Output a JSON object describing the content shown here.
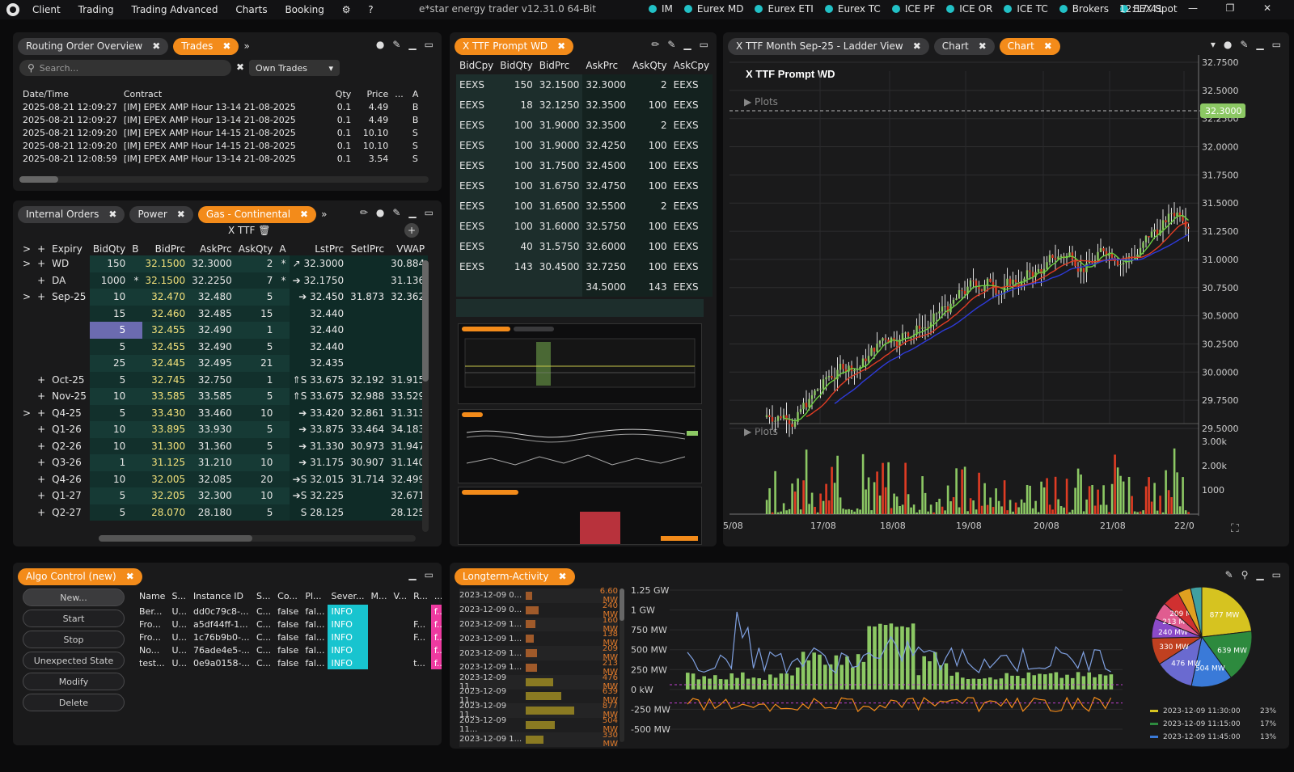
{
  "menu": [
    "Client",
    "Trading",
    "Trading Advanced",
    "Charts",
    "Booking",
    "⚙",
    "?"
  ],
  "app_title": "e*star energy trader v12.31.0 64-Bit",
  "connections": [
    "IM",
    "Eurex MD",
    "Eurex ETI",
    "Eurex TC",
    "ICE PF",
    "ICE OR",
    "ICE TC",
    "Brokers",
    "EEX Spot"
  ],
  "clock": "12:17:41",
  "trades_panel": {
    "tabs": [
      "Routing Order Overview",
      "Trades"
    ],
    "search_placeholder": "Search...",
    "filter": "Own Trades",
    "columns": [
      "Date/Time",
      "Contract",
      "Qty",
      "Price",
      "...",
      "A"
    ],
    "rows": [
      [
        "2025-08-21 12:09:27",
        "[IM] EPEX AMP Hour 13-14 21-08-2025",
        "0.1",
        "4.49",
        "B"
      ],
      [
        "2025-08-21 12:09:27",
        "[IM] EPEX AMP Hour 13-14 21-08-2025",
        "0.1",
        "4.49",
        "B"
      ],
      [
        "2025-08-21 12:09:20",
        "[IM] EPEX AMP Hour 14-15 21-08-2025",
        "0.1",
        "10.10",
        "S"
      ],
      [
        "2025-08-21 12:09:20",
        "[IM] EPEX AMP Hour 14-15 21-08-2025",
        "0.1",
        "10.10",
        "S"
      ],
      [
        "2025-08-21 12:08:59",
        "[IM] EPEX AMP Hour 13-14 21-08-2025",
        "0.1",
        "3.54",
        "S"
      ]
    ]
  },
  "market_panel": {
    "tabs": [
      "Internal Orders",
      "Power",
      "Gas - Continental"
    ],
    "title": "X TTF",
    "columns": [
      ">",
      "+",
      "Expiry",
      "BidQty",
      "B",
      "BidPrc",
      "AskPrc",
      "AskQty",
      "A",
      "LstPrc",
      "SetlPrc",
      "VWAP"
    ],
    "rows": [
      [
        ">",
        "+",
        "WD",
        "150",
        "",
        "32.1500",
        "32.3000",
        "2",
        "*",
        "↗ 32.3000",
        "",
        "30.884"
      ],
      [
        "",
        "+",
        "DA",
        "1000",
        "*",
        "32.1500",
        "32.2250",
        "7",
        "*",
        "➔ 32.1750",
        "",
        "31.136"
      ],
      [
        ">",
        "+",
        "Sep-25",
        "10",
        "",
        "32.470",
        "32.480",
        "5",
        "",
        "➔ 32.450",
        "31.873",
        "32.362"
      ],
      [
        "",
        "",
        "",
        "15",
        "",
        "32.460",
        "32.485",
        "15",
        "",
        "32.440",
        "",
        ""
      ],
      [
        "",
        "",
        "",
        "5",
        "",
        "32.455",
        "32.490",
        "1",
        "",
        "32.440",
        "",
        ""
      ],
      [
        "",
        "",
        "",
        "5",
        "",
        "32.455",
        "32.490",
        "5",
        "",
        "32.440",
        "",
        ""
      ],
      [
        "",
        "",
        "",
        "25",
        "",
        "32.445",
        "32.495",
        "21",
        "",
        "32.435",
        "",
        ""
      ],
      [
        "",
        "+",
        "Oct-25",
        "5",
        "",
        "32.745",
        "32.750",
        "1",
        "",
        "⇑S 33.675",
        "32.192",
        "31.915"
      ],
      [
        "",
        "+",
        "Nov-25",
        "10",
        "",
        "33.585",
        "33.585",
        "5",
        "",
        "⇑S 33.675",
        "32.988",
        "33.529"
      ],
      [
        ">",
        "+",
        "Q4-25",
        "5",
        "",
        "33.430",
        "33.460",
        "10",
        "",
        "➔ 33.420",
        "32.861",
        "31.313"
      ],
      [
        "",
        "+",
        "Q1-26",
        "10",
        "",
        "33.895",
        "33.930",
        "5",
        "",
        "➔ 33.875",
        "33.464",
        "34.183"
      ],
      [
        "",
        "+",
        "Q2-26",
        "10",
        "",
        "31.300",
        "31.360",
        "5",
        "",
        "➔ 31.330",
        "30.973",
        "31.947"
      ],
      [
        "",
        "+",
        "Q3-26",
        "1",
        "",
        "31.125",
        "31.210",
        "10",
        "",
        "➔ 31.175",
        "30.907",
        "31.140"
      ],
      [
        "",
        "+",
        "Q4-26",
        "10",
        "",
        "32.005",
        "32.085",
        "20",
        "",
        "➔S 32.015",
        "31.714",
        "32.499"
      ],
      [
        "",
        "+",
        "Q1-27",
        "5",
        "",
        "32.205",
        "32.300",
        "10",
        "",
        "➔S 32.225",
        "",
        "32.671"
      ],
      [
        "",
        "+",
        "Q2-27",
        "5",
        "",
        "28.070",
        "28.180",
        "5",
        "",
        "S 28.125",
        "",
        "28.125"
      ]
    ]
  },
  "ladder_panel": {
    "tabs": [
      "X TTF Prompt WD"
    ],
    "columns": [
      "BidCpy",
      "BidQty",
      "BidPrc",
      "AskPrc",
      "AskQty",
      "AskCpy"
    ],
    "rows": [
      [
        "EEXS",
        "150",
        "32.1500",
        "32.3000",
        "2",
        "EEXS"
      ],
      [
        "EEXS",
        "18",
        "32.1250",
        "32.3500",
        "100",
        "EEXS"
      ],
      [
        "EEXS",
        "100",
        "31.9000",
        "32.3500",
        "2",
        "EEXS"
      ],
      [
        "EEXS",
        "100",
        "31.9000",
        "32.4250",
        "100",
        "EEXS"
      ],
      [
        "EEXS",
        "100",
        "31.7500",
        "32.4500",
        "100",
        "EEXS"
      ],
      [
        "EEXS",
        "100",
        "31.6750",
        "32.4750",
        "100",
        "EEXS"
      ],
      [
        "EEXS",
        "100",
        "31.6500",
        "32.5500",
        "2",
        "EEXS"
      ],
      [
        "EEXS",
        "100",
        "31.6000",
        "32.5750",
        "100",
        "EEXS"
      ],
      [
        "EEXS",
        "40",
        "31.5750",
        "32.6000",
        "100",
        "EEXS"
      ],
      [
        "EEXS",
        "143",
        "30.4500",
        "32.7250",
        "100",
        "EEXS"
      ],
      [
        "",
        "",
        "",
        "34.5000",
        "143",
        "EEXS"
      ]
    ]
  },
  "chart_panel": {
    "tabs": [
      "X TTF Month Sep-25 - Ladder View",
      "Chart",
      "Chart"
    ],
    "title": "X TTF Prompt WD",
    "plots_label": "Plots",
    "price_marker": "32.3000",
    "y_ticks": [
      "32.7500",
      "32.5000",
      "32.2500",
      "32.0000",
      "31.7500",
      "31.5000",
      "31.2500",
      "31.0000",
      "30.7500",
      "30.5000",
      "30.2500",
      "30.0000",
      "29.7500",
      "29.5000"
    ],
    "vol_ticks": [
      "3.00k",
      "2.00k",
      "1000"
    ],
    "x_ticks": [
      "5/08",
      "17/08",
      "18/08",
      "19/08",
      "20/08",
      "21/08",
      "22/0"
    ]
  },
  "algo_panel": {
    "tabs": [
      "Algo Control (new)"
    ],
    "buttons": [
      "New...",
      "Start",
      "Stop",
      "Unexpected State",
      "Modify",
      "Delete"
    ],
    "columns": [
      "Name",
      "S...",
      "Instance ID",
      "S...",
      "Co...",
      "Pl...",
      "Sever...",
      "M...",
      "V...",
      "R...",
      "..."
    ],
    "rows": [
      [
        "Ber...",
        "U...",
        "dd0c79c8-...",
        "C...",
        "false",
        "fal...",
        "INFO",
        "",
        "",
        "",
        "f..."
      ],
      [
        "Fro...",
        "U...",
        "a5df44ff-1...",
        "C...",
        "false",
        "fal...",
        "INFO",
        "",
        "",
        "F...",
        "f..."
      ],
      [
        "Fro...",
        "U...",
        "1c76b9b0-...",
        "C...",
        "false",
        "fal...",
        "INFO",
        "",
        "",
        "F...",
        "f..."
      ],
      [
        "No...",
        "U...",
        "76ade4e5-...",
        "C...",
        "false",
        "fal...",
        "INFO",
        "",
        "",
        "",
        "f..."
      ],
      [
        "test...",
        "U...",
        "0e9a0158-...",
        "C...",
        "false",
        "fal...",
        "INFO",
        "",
        "",
        "t...",
        "f..."
      ]
    ]
  },
  "activity_panel": {
    "tabs": [
      "Longterm-Activity"
    ],
    "list": [
      [
        "2023-12-09 0...",
        "6.60 MW"
      ],
      [
        "2023-12-09 0...",
        "240 MW"
      ],
      [
        "2023-12-09 1...",
        "160 MW"
      ],
      [
        "2023-12-09 1...",
        "138 MW"
      ],
      [
        "2023-12-09 1...",
        "209 MW"
      ],
      [
        "2023-12-09 1...",
        "213 MW"
      ],
      [
        "2023-12-09 11...",
        "476 MW"
      ],
      [
        "2023-12-09 11...",
        "639 MW"
      ],
      [
        "2023-12-09 11...",
        "877 MW"
      ],
      [
        "2023-12-09 11...",
        "504 MW"
      ],
      [
        "2023-12-09 1...",
        "330 MW"
      ]
    ],
    "y_ticks": [
      "1.25 GW",
      "1 GW",
      "750 MW",
      "500 MW",
      "250 MW",
      "0 kW",
      "-250 MW",
      "-500 MW"
    ],
    "pie_labels": [
      "877 MW",
      "639 MW",
      "504 MW",
      "476 MW",
      "330 MW",
      "240 MW",
      "213 MW",
      "209 MW"
    ],
    "legend": [
      [
        "2023-12-09 11:30:00",
        "23%"
      ],
      [
        "2023-12-09 11:15:00",
        "17%"
      ],
      [
        "2023-12-09 11:45:00",
        "13%"
      ]
    ]
  },
  "colors": {
    "accent": "#f38b1a",
    "teal": "#22c1c6",
    "green": "#8cc864",
    "red": "#e03c24",
    "info": "#18c4cf",
    "pink": "#ee3aa0"
  }
}
